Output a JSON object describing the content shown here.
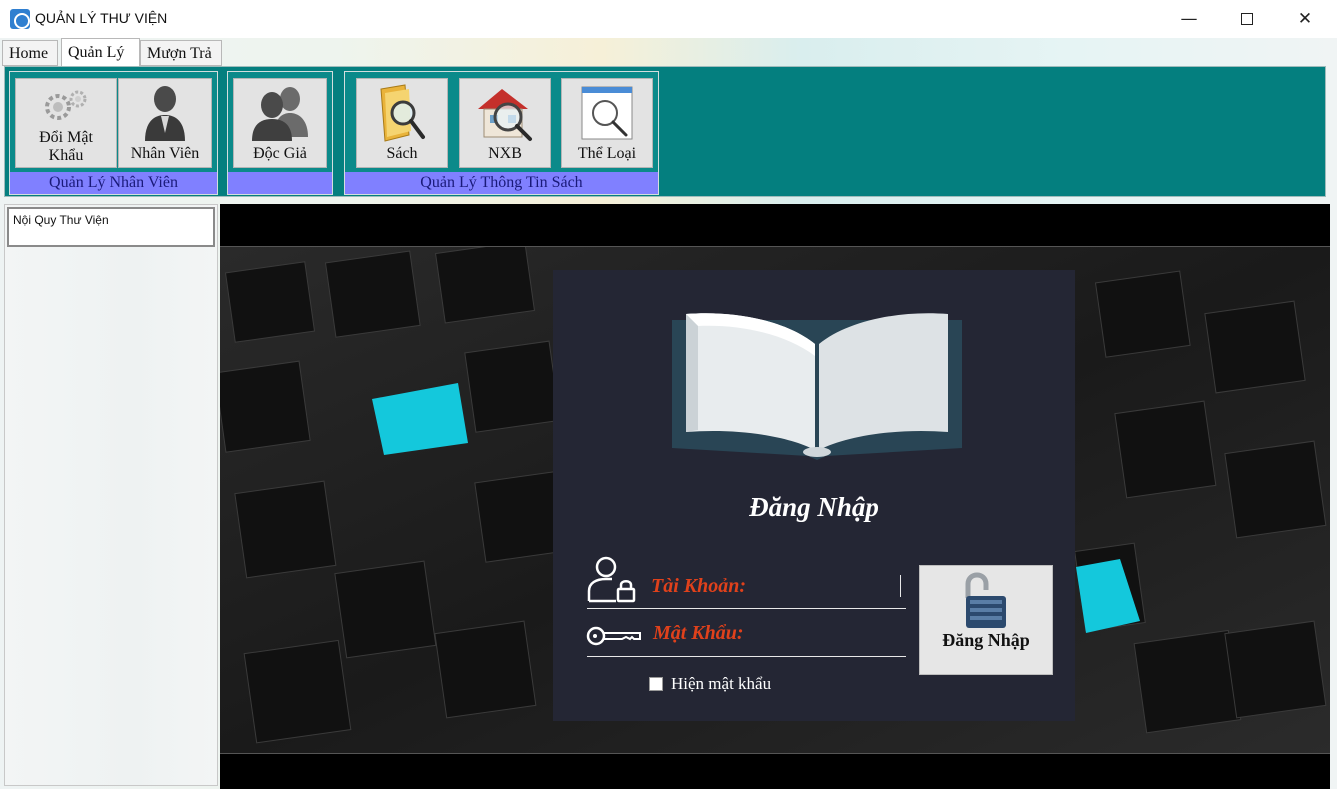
{
  "window": {
    "title": "QUẢN LÝ THƯ VIỆN",
    "minimize": "—",
    "close": "✕"
  },
  "menu": {
    "tabs": [
      "Home",
      "Quản Lý",
      "Mượn Trả"
    ],
    "active_tab": "Quản Lý"
  },
  "ribbon": {
    "groups": [
      {
        "label": "Quản Lý Nhân Viên",
        "buttons": [
          {
            "label_line1": "Đổi Mật",
            "label_line2": "Khẩu",
            "icon": "gears-icon"
          },
          {
            "label": "Nhân Viên",
            "icon": "user-icon"
          }
        ]
      },
      {
        "label": "",
        "buttons": [
          {
            "label": "Độc Giả",
            "icon": "users-icon"
          }
        ]
      },
      {
        "label": "Quản Lý Thông Tin Sách",
        "buttons": [
          {
            "label": "Sách",
            "icon": "folder-search-icon"
          },
          {
            "label": "NXB",
            "icon": "house-search-icon"
          },
          {
            "label": "Thể Loại",
            "icon": "window-search-icon"
          }
        ]
      }
    ]
  },
  "left_panel": {
    "items": [
      "Nội Quy Thư Viện"
    ]
  },
  "login": {
    "title": "Đăng Nhập",
    "username_label": "Tài Khoản:",
    "username_value": "",
    "password_label": "Mật Khẩu:",
    "password_value": "",
    "show_password_label": "Hiện mật khẩu",
    "show_password_checked": false,
    "submit_label": "Đăng Nhập"
  },
  "colors": {
    "ribbon_bg": "#047f7f",
    "group_label_bg": "#8080ff",
    "login_card_bg": "#242634",
    "field_label": "#e0411b",
    "accent_cyan": "#14c8dc"
  }
}
